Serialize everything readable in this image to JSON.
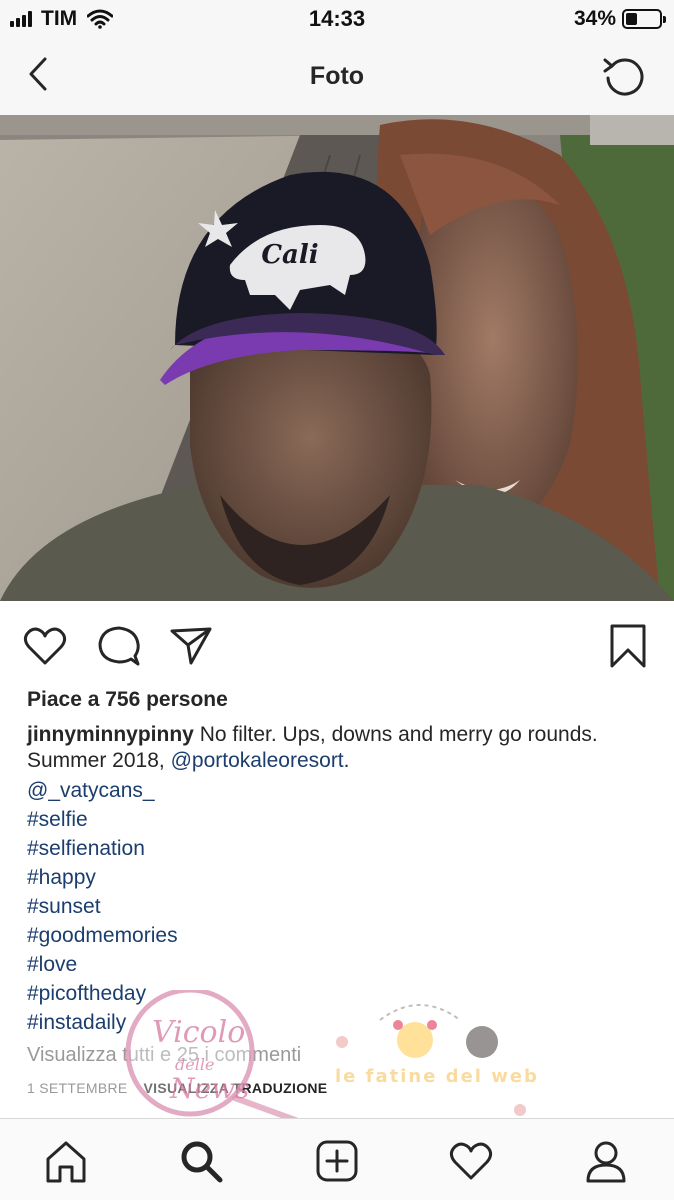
{
  "status_bar": {
    "carrier": "TIM",
    "time": "14:33",
    "battery_percent_text": "34%",
    "battery_level": 0.34,
    "icons": [
      "signal-icon",
      "wifi-icon",
      "battery-icon"
    ]
  },
  "nav": {
    "title": "Foto",
    "back_icon": "chevron-left-icon",
    "refresh_icon": "refresh-icon"
  },
  "post": {
    "photo_cap_text": "Cali",
    "actions": [
      "heart-icon",
      "comment-icon",
      "share-icon",
      "bookmark-icon"
    ],
    "likes_text": "Piace a 756 persone",
    "caption": {
      "username": "jinnyminnypinny",
      "text": "No filter. Ups, downs and merry go rounds. Summer 2018,",
      "mention": "@portokaleoresort",
      "end": "."
    },
    "tags": [
      "@_vatycans_",
      "#selfie",
      "#selfienation",
      "#happy",
      "#sunset",
      "#goodmemories",
      "#love",
      "#picoftheday",
      "#instadaily"
    ],
    "view_comments": "Visualizza tutti e 25 i commenti",
    "date": "1 SETTEMBRE",
    "translate": "VISUALIZZA TRADUZIONE"
  },
  "watermark": {
    "line1": "Vicolo",
    "line2": "delle",
    "line3": "News",
    "banner": "le fatine del web"
  },
  "tab_bar": {
    "icons": [
      "home-icon",
      "search-icon",
      "add-post-icon",
      "activity-heart-icon",
      "profile-icon"
    ],
    "active": "search-icon"
  },
  "colors": {
    "link": "#1c3e6e",
    "muted": "#999999",
    "bar_background": "#f7f7f7",
    "cap_purple": "#7a3bb0"
  }
}
